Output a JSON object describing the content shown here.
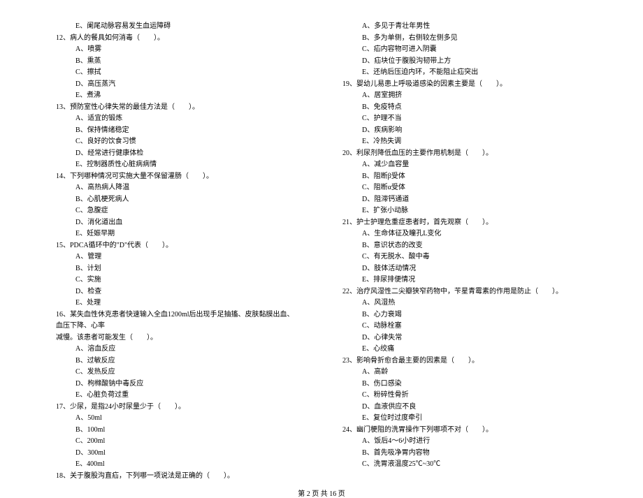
{
  "leftColumn": [
    {
      "type": "option",
      "text": "E、阑尾动脉容易发生血运障碍"
    },
    {
      "type": "question",
      "text": "12、病人的餐具如何消毒（　　）。"
    },
    {
      "type": "option",
      "text": "A、喷雾"
    },
    {
      "type": "option",
      "text": "B、熏蒸"
    },
    {
      "type": "option",
      "text": "C、擦拭"
    },
    {
      "type": "option",
      "text": "D、高压蒸汽"
    },
    {
      "type": "option",
      "text": "E、煮沸"
    },
    {
      "type": "question",
      "text": "13、预防室性心律失常的最佳方法是（　　）。"
    },
    {
      "type": "option",
      "text": "A、适宜的锻炼"
    },
    {
      "type": "option",
      "text": "B、保持情绪稳定"
    },
    {
      "type": "option",
      "text": "C、良好的饮食习惯"
    },
    {
      "type": "option",
      "text": "D、经常进行健康体检"
    },
    {
      "type": "option",
      "text": "E、控制器质性心脏病病情"
    },
    {
      "type": "question",
      "text": "14、下列哪种情况可实施大量不保留灌肠（　　）。"
    },
    {
      "type": "option",
      "text": "A、高热病人降温"
    },
    {
      "type": "option",
      "text": "B、心肌梗死病人"
    },
    {
      "type": "option",
      "text": "C、急腹症"
    },
    {
      "type": "option",
      "text": "D、消化道出血"
    },
    {
      "type": "option",
      "text": "E、妊娠早期"
    },
    {
      "type": "question",
      "text": "15、PDCA循环中的\"D\"代表（　　）。"
    },
    {
      "type": "option",
      "text": "A、管理"
    },
    {
      "type": "option",
      "text": "B、计划"
    },
    {
      "type": "option",
      "text": "C、实施"
    },
    {
      "type": "option",
      "text": "D、检查"
    },
    {
      "type": "option",
      "text": "E、处理"
    },
    {
      "type": "question",
      "text": "16、某失血性休克患者快速输入全血1200ml后出现手足抽搐、皮肤黏膜出血、血压下降、心率"
    },
    {
      "type": "question-cont",
      "text": "减慢。该患者可能发生（　　）。"
    },
    {
      "type": "option",
      "text": "A、溶血反应"
    },
    {
      "type": "option",
      "text": "B、过敏反应"
    },
    {
      "type": "option",
      "text": "C、发热反应"
    },
    {
      "type": "option",
      "text": "D、枸橼酸钠中毒反应"
    },
    {
      "type": "option",
      "text": "E、心脏负荷过重"
    },
    {
      "type": "question",
      "text": "17、少尿，是指24小时尿量少于（　　）。"
    },
    {
      "type": "option",
      "text": "A、50ml"
    },
    {
      "type": "option",
      "text": "B、100ml"
    },
    {
      "type": "option",
      "text": "C、200ml"
    },
    {
      "type": "option",
      "text": "D、300ml"
    },
    {
      "type": "option",
      "text": "E、400ml"
    },
    {
      "type": "question",
      "text": "18、关于腹股沟直疝，下列哪一项说法是正确的（　　）。"
    }
  ],
  "rightColumn": [
    {
      "type": "option",
      "text": "A、多见于青壮年男性"
    },
    {
      "type": "option",
      "text": "B、多为单侧，右侧较左侧多见"
    },
    {
      "type": "option",
      "text": "C、疝内容物可进入阴囊"
    },
    {
      "type": "option",
      "text": "D、疝块位于腹股沟韧带上方"
    },
    {
      "type": "option",
      "text": "E、还纳后压迫内环，不能阻止疝突出"
    },
    {
      "type": "question",
      "text": "19、婴幼儿易患上呼吸道感染的因素主要是（　　）。"
    },
    {
      "type": "option",
      "text": "A、居室拥挤"
    },
    {
      "type": "option",
      "text": "B、免疫特点"
    },
    {
      "type": "option",
      "text": "C、护理不当"
    },
    {
      "type": "option",
      "text": "D、疾病影响"
    },
    {
      "type": "option",
      "text": "E、冷热失调"
    },
    {
      "type": "question",
      "text": "20、利尿剂降低血压的主要作用机制是（　　）。"
    },
    {
      "type": "option",
      "text": "A、减少血容量"
    },
    {
      "type": "option",
      "text": "B、阻断β受体"
    },
    {
      "type": "option",
      "text": "C、阻断α受体"
    },
    {
      "type": "option",
      "text": "D、阻滞钙通道"
    },
    {
      "type": "option",
      "text": "E、扩张小动脉"
    },
    {
      "type": "question",
      "text": "21、护士护理危重症患者时，首先观察（　　）。"
    },
    {
      "type": "option",
      "text": "A、生命体征及瞳孔L变化"
    },
    {
      "type": "option",
      "text": "B、意识状态的改变"
    },
    {
      "type": "option",
      "text": "C、有无脱水、酸中毒"
    },
    {
      "type": "option",
      "text": "D、肢体活动情况"
    },
    {
      "type": "option",
      "text": "E、排尿排便情况"
    },
    {
      "type": "question",
      "text": "22、治疗风湿性二尖瓣狭窄药物中，苄星青霉素的作用是防止（　　）。"
    },
    {
      "type": "option",
      "text": "A、风湿热"
    },
    {
      "type": "option",
      "text": "B、心力衰竭"
    },
    {
      "type": "option",
      "text": "C、动脉栓塞"
    },
    {
      "type": "option",
      "text": "D、心律失常"
    },
    {
      "type": "option",
      "text": "E、心绞痛"
    },
    {
      "type": "question",
      "text": "23、影响骨折愈合最主要的因素是（　　）。"
    },
    {
      "type": "option",
      "text": "A、高龄"
    },
    {
      "type": "option",
      "text": "B、伤口感染"
    },
    {
      "type": "option",
      "text": "C、粉碎性骨折"
    },
    {
      "type": "option",
      "text": "D、血液供应不良"
    },
    {
      "type": "option",
      "text": "E、复位时过度牵引"
    },
    {
      "type": "question",
      "text": "24、幽门梗阻的洗胃操作下列哪项不对（　　）。"
    },
    {
      "type": "option",
      "text": "A、饭后4～6小时进行"
    },
    {
      "type": "option",
      "text": "B、首先吸净胃内容物"
    },
    {
      "type": "option",
      "text": "C、洗胃液温度25℃~30℃"
    }
  ],
  "footer": "第 2 页 共 16 页"
}
